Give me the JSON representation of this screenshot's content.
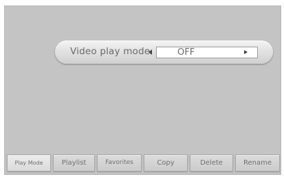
{
  "setting": {
    "label": "Video play mode",
    "value": "OFF"
  },
  "toolbar": {
    "buttons": [
      {
        "label": "Play Mode"
      },
      {
        "label": "Playlist"
      },
      {
        "label": "Favorites"
      },
      {
        "label": "Copy"
      },
      {
        "label": "Delete"
      },
      {
        "label": "Rename"
      }
    ]
  }
}
